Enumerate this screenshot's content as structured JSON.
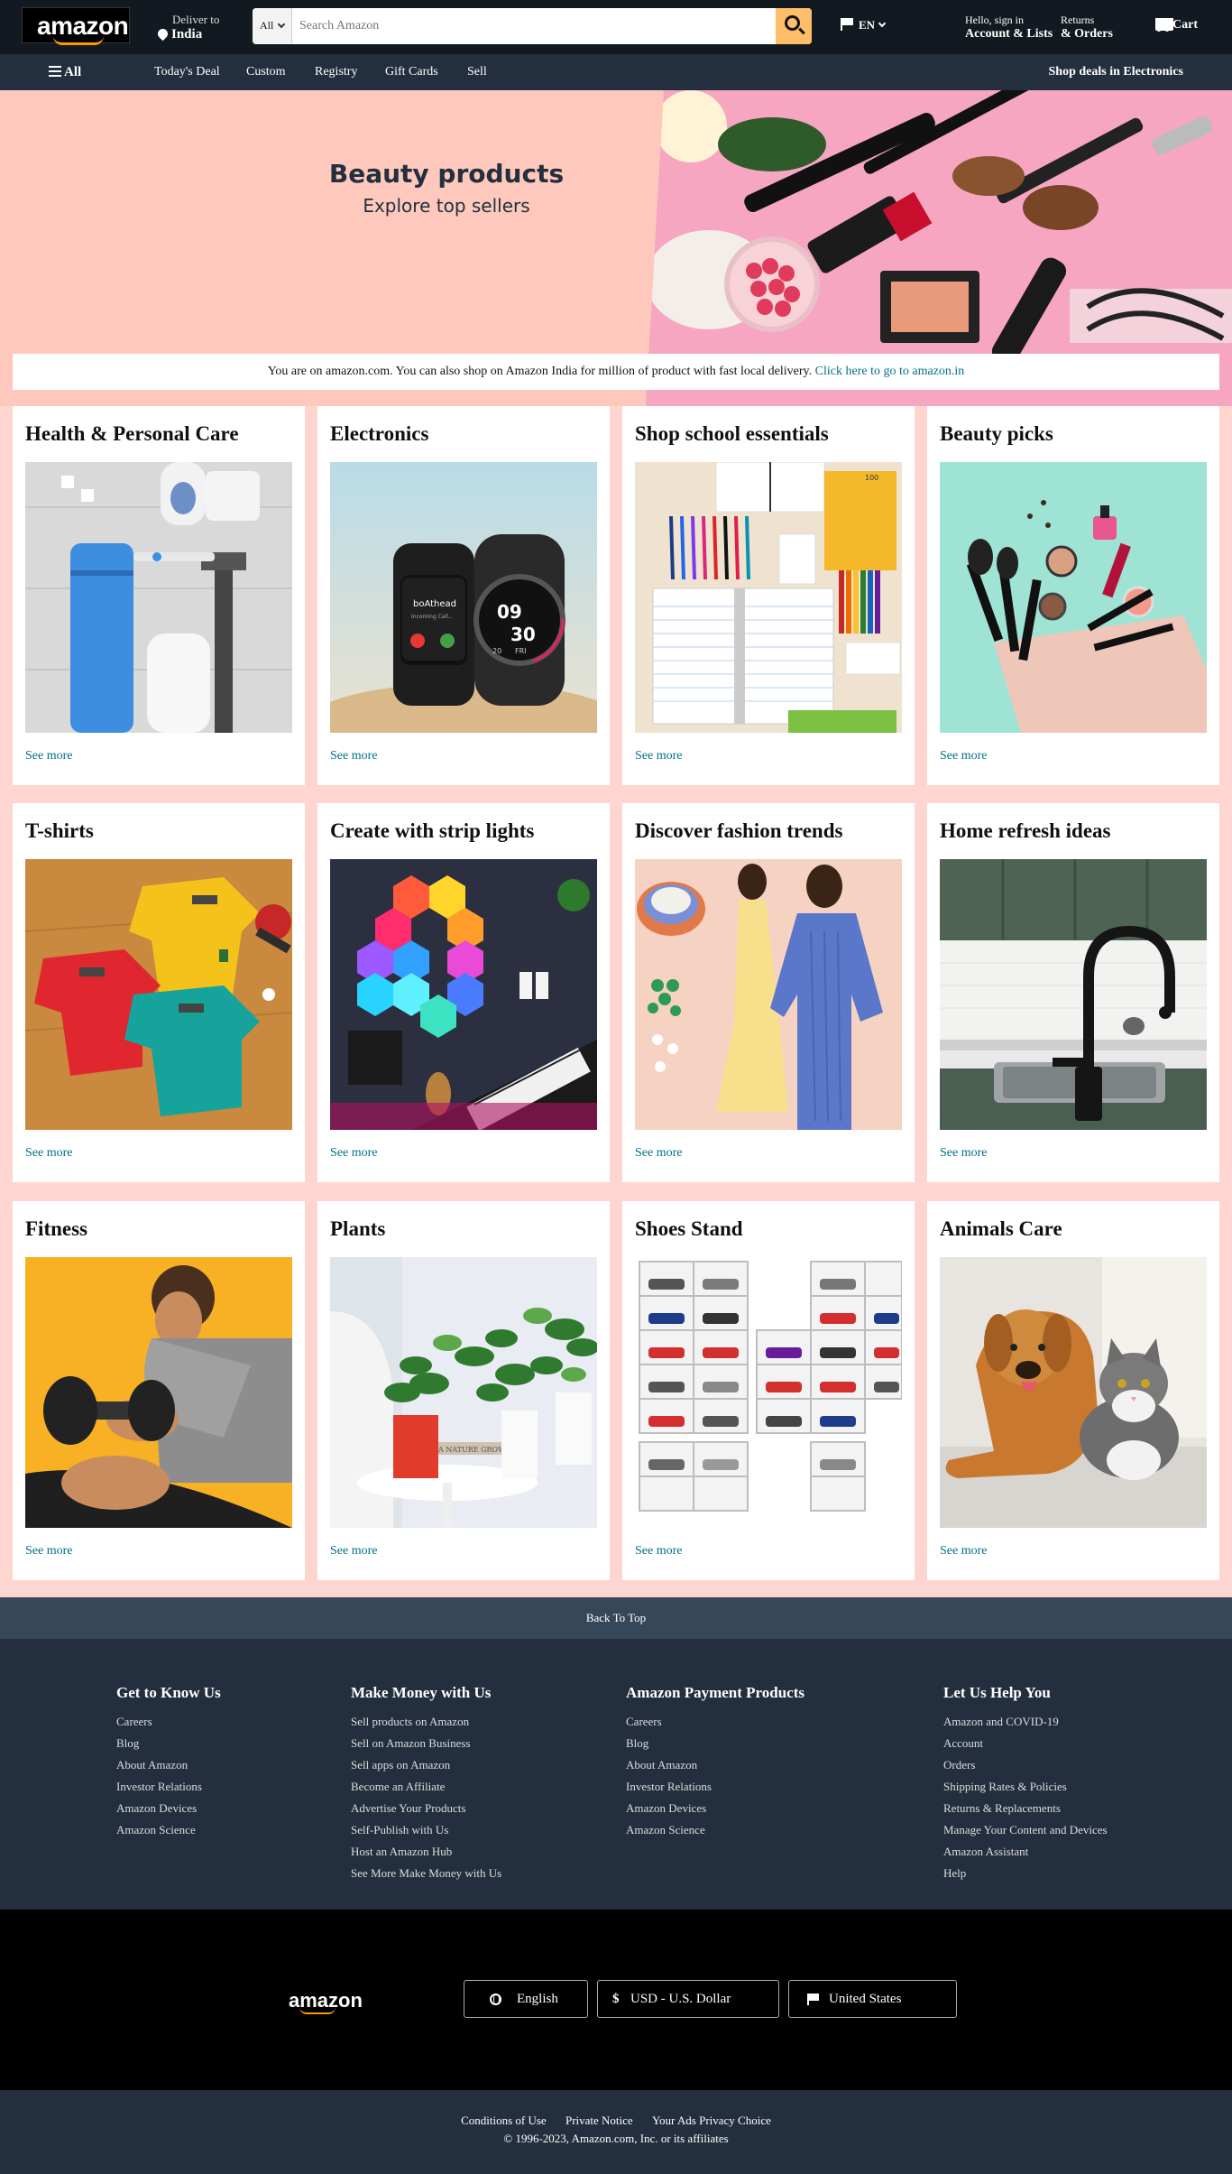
{
  "header": {
    "logo": "amazon",
    "deliver_to": "Deliver to",
    "location": "India",
    "search_category": "All",
    "search_placeholder": "Search Amazon",
    "language": "EN",
    "account_greeting": "Hello, sign in",
    "account_label": "Account & Lists",
    "returns": "Returns",
    "orders": "& Orders",
    "cart": "Cart"
  },
  "nav": {
    "all": "All",
    "items": [
      "Today's Deal",
      "Custom",
      "Registry",
      "Gift Cards",
      "Sell"
    ],
    "promo": "Shop deals in Electronics"
  },
  "hero": {
    "title": "Beauty products",
    "subtitle": "Explore top sellers"
  },
  "notice": {
    "text": "You are on amazon.com. You can also shop on Amazon India for million of product with fast local delivery.",
    "link": "Click here to go to amazon.in"
  },
  "cards": [
    {
      "title": "Health & Personal Care",
      "link": "See more"
    },
    {
      "title": "Electronics",
      "link": "See more"
    },
    {
      "title": "Shop school essentials",
      "link": "See more"
    },
    {
      "title": "Beauty picks",
      "link": "See more"
    },
    {
      "title": "T-shirts",
      "link": "See more"
    },
    {
      "title": "Create with strip lights",
      "link": "See more"
    },
    {
      "title": "Discover fashion trends",
      "link": "See more"
    },
    {
      "title": "Home refresh ideas",
      "link": "See more"
    },
    {
      "title": "Fitness",
      "link": "See more"
    },
    {
      "title": "Plants",
      "link": "See more"
    },
    {
      "title": "Shoes Stand",
      "link": "See more"
    },
    {
      "title": "Animals Care",
      "link": "See more"
    }
  ],
  "image_text": {
    "watch_brand": "boAthead",
    "watch_sub": "Incoming Call...",
    "watch_time_h": "09",
    "watch_time_m": "30",
    "watch_date": "20",
    "watch_day": "FRI",
    "book_text": "A NATURE GROW"
  },
  "footer": {
    "back_to_top": "Back To Top",
    "columns": [
      {
        "title": "Get to Know Us",
        "links": [
          "Careers",
          "Blog",
          "About Amazon",
          "Investor Relations",
          "Amazon Devices",
          "Amazon Science"
        ]
      },
      {
        "title": "Make Money with Us",
        "links": [
          "Sell products on Amazon",
          "Sell on Amazon Business",
          "Sell apps on Amazon",
          "Become an Affiliate",
          "Advertise Your Products",
          "Self-Publish with Us",
          "Host an Amazon Hub",
          "See More Make Money with Us"
        ]
      },
      {
        "title": "Amazon Payment Products",
        "links": [
          "Careers",
          "Blog",
          "About Amazon",
          "Investor Relations",
          "Amazon Devices",
          "Amazon Science"
        ]
      },
      {
        "title": "Let Us Help You",
        "links": [
          "Amazon and COVID-19",
          "Account",
          "Orders",
          "Shipping Rates & Policies",
          "Returns & Replacements",
          "Manage Your Content and Devices",
          "Amazon Assistant",
          "Help"
        ]
      }
    ],
    "logo": "amazon",
    "language": "English",
    "currency": "USD - U.S. Dollar",
    "country": "United States",
    "bottom_links": [
      "Conditions of Use",
      "Private Notice",
      "Your Ads Privacy Choice"
    ],
    "copyright": "© 1996-2023, Amazon.com, Inc. or its affiliates"
  }
}
